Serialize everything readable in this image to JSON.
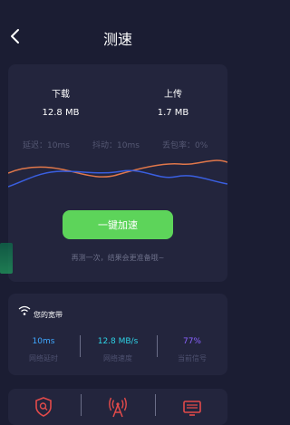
{
  "header": {
    "title": "测速"
  },
  "test": {
    "download": {
      "label": "下载",
      "value": "12.8 MB"
    },
    "upload": {
      "label": "上传",
      "value": "1.7 MB"
    },
    "stats": {
      "latency": "延迟：10ms",
      "jitter": "抖动：10ms",
      "loss": "丢包率：0%"
    },
    "button_label": "一键加速",
    "hint": "再测一次，结果会更准备哦~"
  },
  "broadband": {
    "title": "您的宽带",
    "metrics": [
      {
        "value": "10ms",
        "label": "网络延时",
        "color": "#3fa7ff"
      },
      {
        "value": "12.8 MB/s",
        "label": "网络速度",
        "color": "#2ed3e6"
      },
      {
        "value": "77%",
        "label": "当前信号",
        "color": "#8a62ff"
      }
    ]
  },
  "colors": {
    "background": "#1b1d33",
    "card": "#23253d",
    "accent_green": "#5dd45a",
    "upload_wave": "#e0774a",
    "download_wave": "#3a5fe0",
    "tool_icon": "#e24a4a"
  },
  "tools": [
    {
      "icon": "shield-search-icon"
    },
    {
      "icon": "signal-tower-icon"
    },
    {
      "icon": "tv-screen-icon"
    }
  ]
}
